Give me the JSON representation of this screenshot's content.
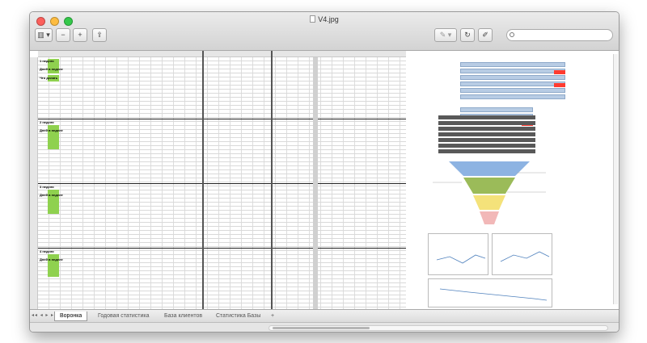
{
  "window": {
    "title": "V4.jpg"
  },
  "toolbar": {
    "view_label": "▥ ▾",
    "zoom_out_label": "−",
    "zoom_in_label": "+",
    "share_label": "⇪",
    "annotate_label": "✎ ▾",
    "rotate_label": "↻",
    "edit_label": "✐",
    "markup_label": "⌂",
    "search_placeholder": ""
  },
  "sheet": {
    "blocks": [
      {
        "label": "1 неделя",
        "subrows": [
          "Дней в неделе",
          "Что делать"
        ]
      },
      {
        "label": "2 неделя",
        "subrows": [
          "Дней в неделе"
        ]
      },
      {
        "label": "3 неделя",
        "subrows": [
          "Дней в неделе"
        ]
      },
      {
        "label": "4 неделя",
        "subrows": [
          "Дней в неделе"
        ]
      }
    ]
  },
  "sheet_tabs": [
    {
      "label": "Воронка",
      "active": true
    },
    {
      "label": "Годовая статистика",
      "active": false
    },
    {
      "label": "База клиентов",
      "active": false
    },
    {
      "label": "Статистика Базы",
      "active": false
    },
    {
      "label": "+",
      "active": false
    }
  ],
  "colors": {
    "green": "#8fd14f",
    "blue": "#b8cce4",
    "red": "#ff3b30",
    "funnel_blue": "#8db3e2",
    "funnel_green": "#9bbb59",
    "funnel_yellow": "#f4e27a",
    "funnel_pink": "#f2b8b8"
  }
}
